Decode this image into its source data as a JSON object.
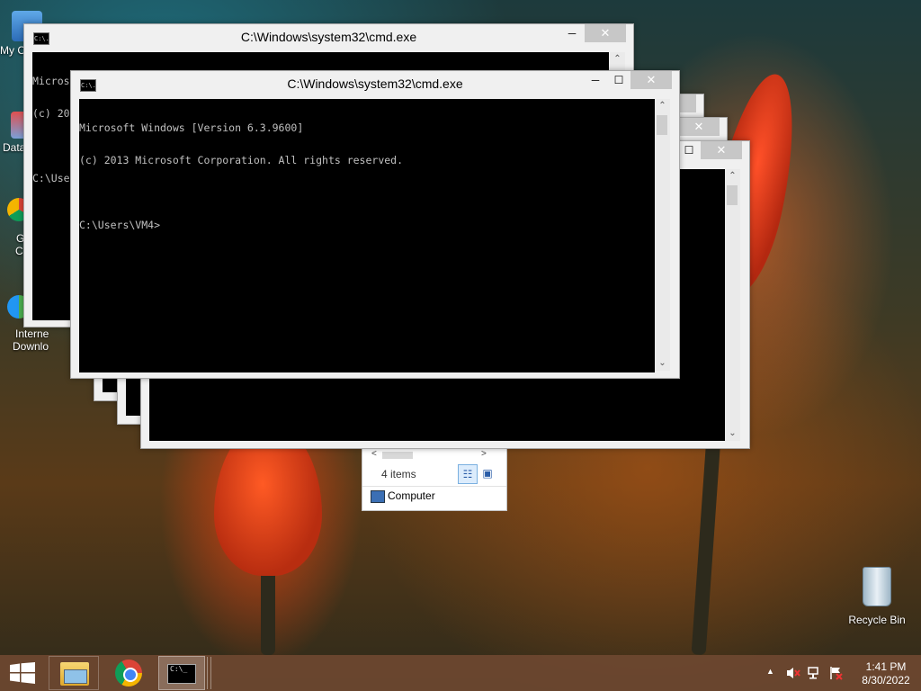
{
  "desktop": {
    "icons": [
      {
        "label": "My C"
      },
      {
        "label": "Data"
      },
      {
        "label": "G"
      },
      {
        "label": "C"
      },
      {
        "label": "Interne"
      },
      {
        "label": "Downlo"
      },
      {
        "label": "Recycle Bin"
      }
    ]
  },
  "cmd": {
    "title": "C:\\Windows\\system32\\cmd.exe",
    "icon_text": "C:\\.",
    "line1": "Microsoft Windows [Version 6.3.9600]",
    "line2": "(c) 2013 Microsoft Corporation. All rights reserved.",
    "prompt": "C:\\Users\\VM4>",
    "prompt_partial": "C:\\Use",
    "minimize": "─",
    "maximize": "☐",
    "close": "✕",
    "scroll_up": "⌃",
    "scroll_down": "⌄"
  },
  "explorer": {
    "item_count": "4 items",
    "location": "Computer",
    "scroll_left": "<",
    "scroll_right": ">",
    "details_view": "☷",
    "large_icons_view": "▣"
  },
  "taskbar": {
    "start": "start-icon",
    "apps": [
      "file-explorer-icon",
      "chrome-icon",
      "cmd-icon"
    ],
    "tray_chevron": "▲",
    "time": "1:41 PM",
    "date": "8/30/2022"
  },
  "colors": {
    "taskbar": "#6e4830",
    "console_bg": "#000000",
    "console_fg": "#c0c0c0",
    "close_btn": "#c7c7c7"
  }
}
